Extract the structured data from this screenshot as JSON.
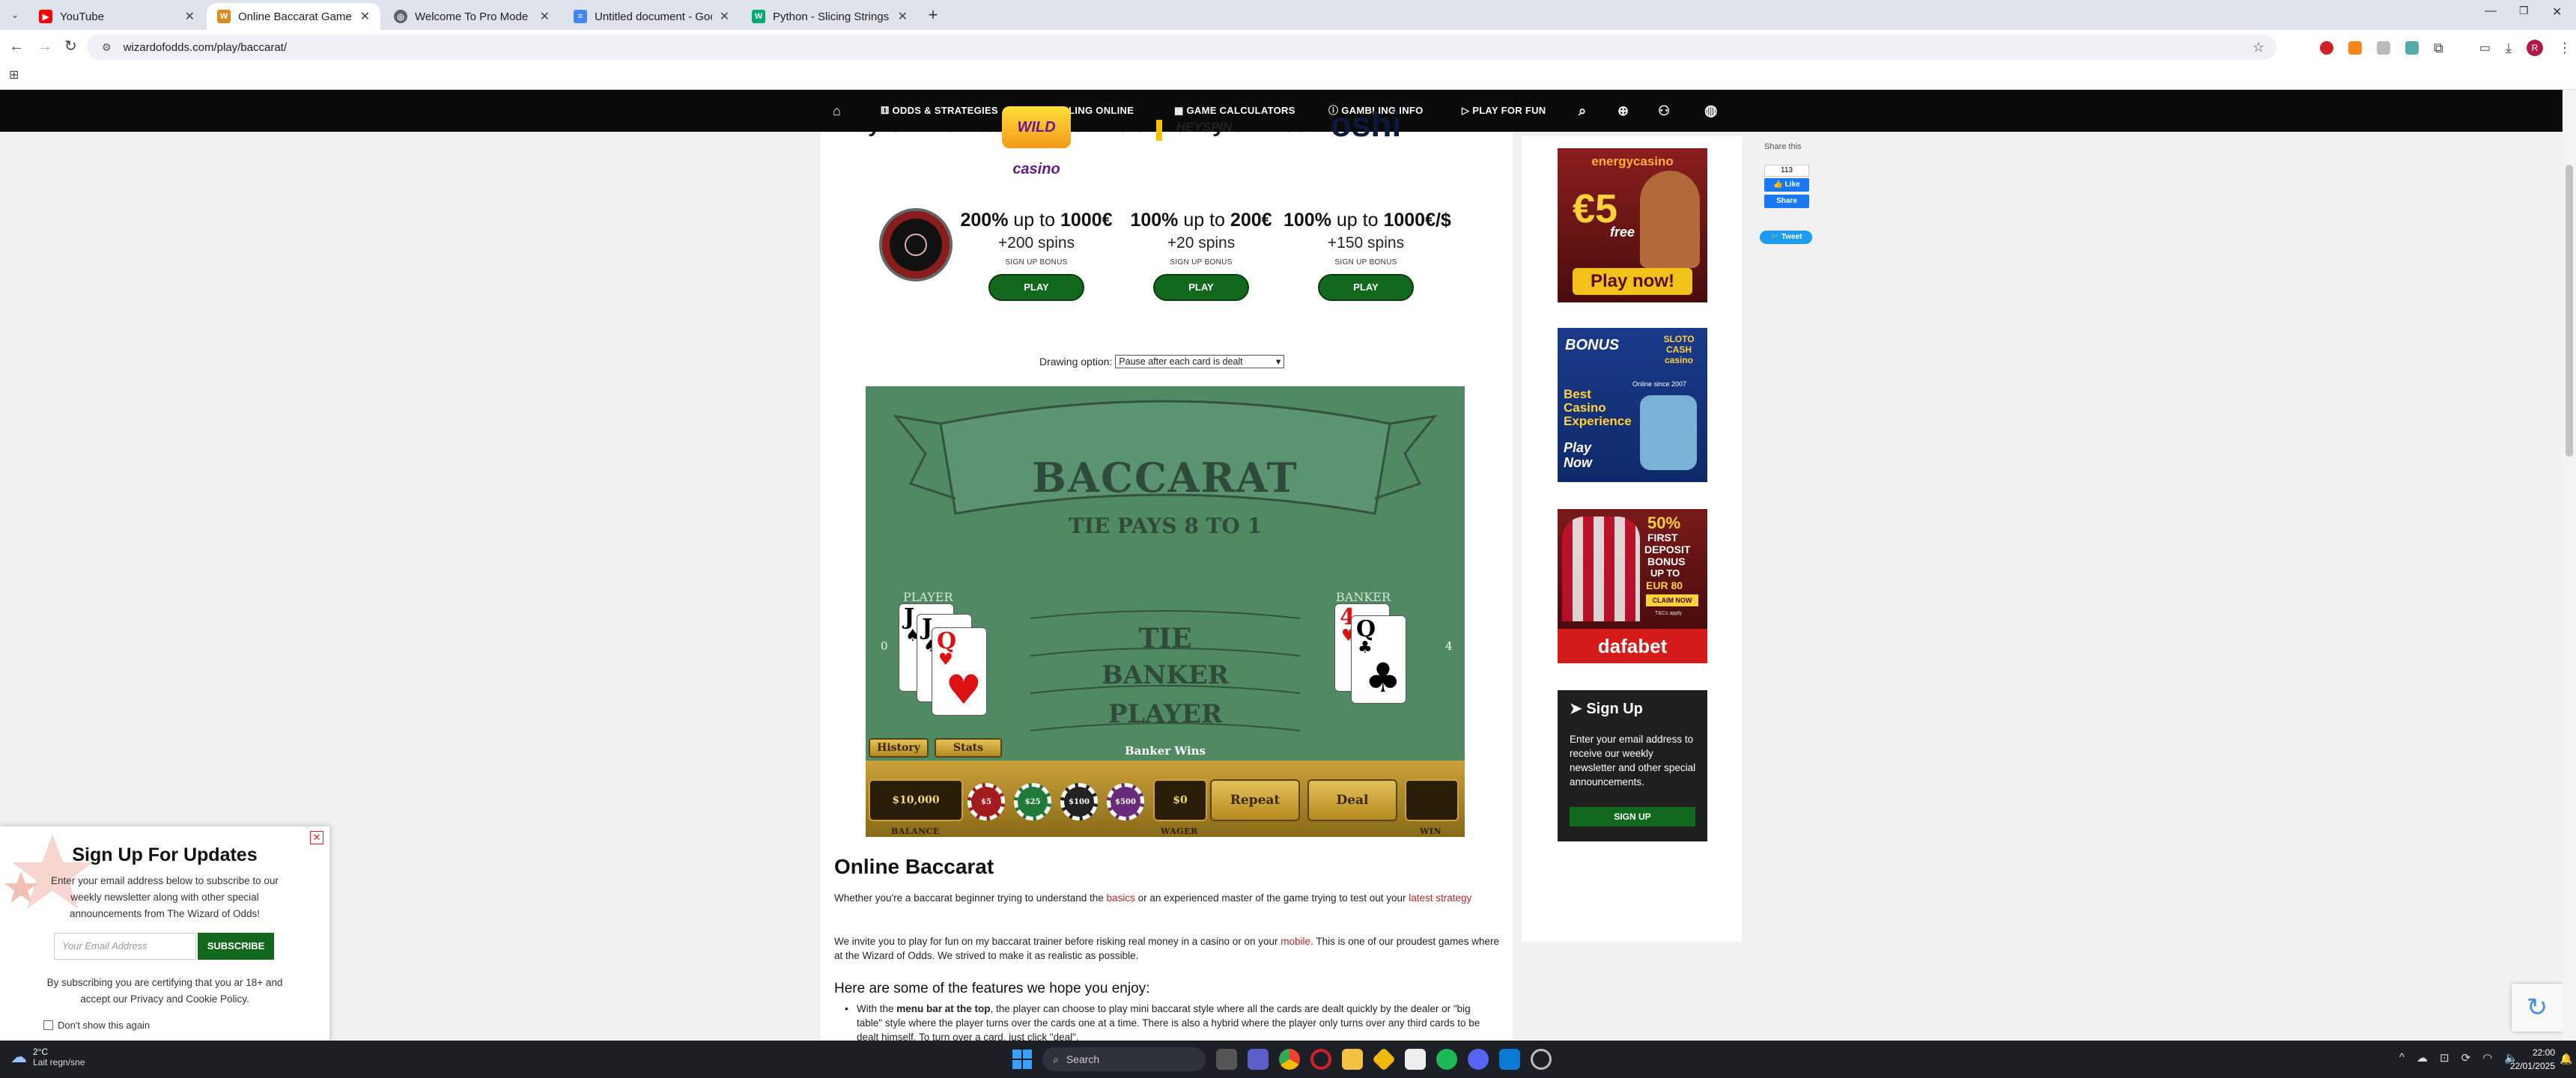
{
  "browser": {
    "tabs": [
      {
        "title": "YouTube",
        "active": false,
        "favicon_color": "#ff0000"
      },
      {
        "title": "Online Baccarat Game - Pla",
        "active": true,
        "favicon_color": "#d98c1f"
      },
      {
        "title": "Welcome To Pro Mode",
        "active": false,
        "favicon_color": "#5f6368"
      },
      {
        "title": "Untitled document - Google D",
        "active": false,
        "favicon_color": "#4285f4"
      },
      {
        "title": "Python - Slicing Strings",
        "active": false,
        "favicon_color": "#04aa6d"
      }
    ],
    "new_tab": "+",
    "url": "wizardofodds.com/play/baccarat/",
    "profile_initial": "R"
  },
  "site_nav": {
    "items": [
      "ODDS & STRATEGIES",
      "GAMBLING ONLINE",
      "GAME CALCULATORS",
      "GAMBLING INFO",
      "PLAY FOR FUN"
    ]
  },
  "page": {
    "heading_partial": "Play Online Baccarat for Real Money or Free",
    "offers": [
      {
        "logo": "WILD casino",
        "percent": "200%",
        "upto": "up to",
        "amount": "1000€",
        "spins": "+200 spins",
        "sub": "SIGN UP BONUS",
        "play": "PLAY"
      },
      {
        "logo": "HEYSPIN",
        "percent": "100%",
        "upto": "up to",
        "amount": "200€",
        "spins": "+20 spins",
        "sub": "SIGN UP BONUS",
        "play": "PLAY"
      },
      {
        "logo": "oshi",
        "percent": "100%",
        "upto": "up to",
        "amount": "1000€/$",
        "spins": "+150 spins",
        "sub": "SIGN UP BONUS",
        "play": "PLAY"
      }
    ],
    "drawing_option_label": "Drawing option:",
    "drawing_option_value": "Pause after each card is dealt"
  },
  "game": {
    "title": "BACCARAT",
    "subtitle": "TIE PAYS 8 TO 1",
    "player_label": "PLAYER",
    "banker_label": "BANKER",
    "player_score": "0",
    "banker_score": "4",
    "bet_areas": [
      "TIE",
      "BANKER",
      "PLAYER"
    ],
    "player_cards": [
      {
        "rank": "J",
        "suit": "♠",
        "color": "#111"
      },
      {
        "rank": "J",
        "suit": "♠",
        "color": "#111"
      },
      {
        "rank": "Q",
        "suit": "♥",
        "color": "#d11"
      }
    ],
    "banker_cards": [
      {
        "rank": "4",
        "suit": "♥",
        "color": "#d11"
      },
      {
        "rank": "Q",
        "suit": "♣",
        "color": "#111"
      }
    ],
    "history_btn": "History",
    "stats_btn": "Stats",
    "result": "Banker Wins",
    "balance": "$10,000",
    "balance_label": "BALANCE",
    "chips": [
      {
        "label": "$5",
        "color": "#a11d1d"
      },
      {
        "label": "$25",
        "color": "#1f7a3a"
      },
      {
        "label": "$100",
        "color": "#222"
      },
      {
        "label": "$500",
        "color": "#6a2a7a"
      }
    ],
    "wager": "$0",
    "wager_label": "WAGER",
    "repeat_btn": "Repeat",
    "deal_btn": "Deal",
    "win_value": "",
    "win_label": "WIN"
  },
  "article": {
    "h2": "Online Baccarat",
    "p1_a": "Whether you're a baccarat beginner trying to understand the ",
    "p1_link1": "basics",
    "p1_b": " or an experienced master of the game trying to test out your ",
    "p1_link2": "latest strategy",
    "p2_a": "We invite you to play for fun on my baccarat trainer before risking real money in a casino or on your ",
    "p2_link": "mobile",
    "p2_b": ". This is one of our proudest games where at the Wizard of Odds. We strived to make it as realistic as possible.",
    "h3": "Here are some of the features we hope you enjoy:",
    "li_a": "With the ",
    "li_bold": "menu bar at the top",
    "li_b": ", the player can choose to play mini baccarat style where all the cards are dealt quickly by the dealer or \"big table\" style where the player turns over the cards one at a time. There is also a hybrid where the player only turns over any third cards to be dealt himself. To turn over a card, just click \"deal\"."
  },
  "sidebar": {
    "ad1": {
      "brand": "energycasino",
      "offer": "€5",
      "offer_sub": "free",
      "cta": "Play now!"
    },
    "ad2": {
      "brand": "BONUS",
      "brand2": "SLOTO CASH casino",
      "since": "Online since 2007",
      "text": "Best Casino Experience",
      "cta": "Play Now"
    },
    "ad3": {
      "pct": "50%",
      "line1": "FIRST",
      "line2": "DEPOSIT",
      "line3": "BONUS",
      "line4": "UP TO",
      "line5": "EUR 80",
      "claim": "CLAIM NOW",
      "tc": "T&Cs apply",
      "brand": "dafabet"
    },
    "signup": {
      "title": "Sign Up",
      "text": "Enter your email address to receive our weekly newsletter and other special announcements.",
      "button": "SIGN UP"
    }
  },
  "share": {
    "label": "Share this",
    "count": "113",
    "like": "Like",
    "share": "Share",
    "tweet": "Tweet"
  },
  "popup": {
    "title": "Sign Up For Updates",
    "text": "Enter your email address below to subscribe to our weekly newsletter along with other special announcements from The Wizard of Odds!",
    "placeholder": "Your Email Address",
    "subscribe": "SUBSCRIBE",
    "legal": "By subscribing you are certifying that you ar 18+ and accept our Privacy and Cookie Policy.",
    "dont_show": "Don't show this again"
  },
  "taskbar": {
    "weather_temp": "2°C",
    "weather_text": "Lait regn/sne",
    "search": "Search",
    "time": "22:00",
    "date": "22/01/2025"
  }
}
